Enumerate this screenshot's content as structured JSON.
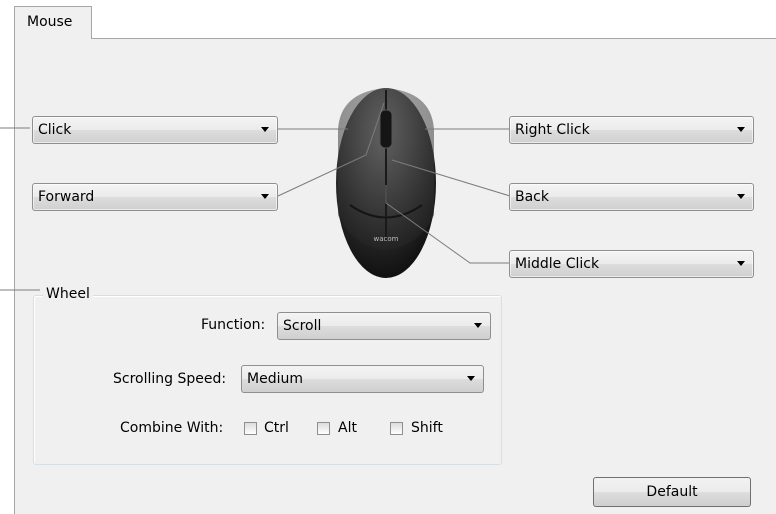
{
  "tab": {
    "label": "Mouse"
  },
  "buttons": {
    "left": {
      "value": "Click"
    },
    "left_side": {
      "value": "Forward"
    },
    "right": {
      "value": "Right Click"
    },
    "right_side": {
      "value": "Back"
    },
    "middle": {
      "value": "Middle Click"
    }
  },
  "mouse": {
    "brand": "wacom"
  },
  "wheel": {
    "title": "Wheel",
    "function_label": "Function:",
    "function_value": "Scroll",
    "speed_label": "Scrolling Speed:",
    "speed_value": "Medium",
    "combine_label": "Combine With:",
    "modifiers": [
      {
        "label": "Ctrl",
        "checked": false
      },
      {
        "label": "Alt",
        "checked": false
      },
      {
        "label": "Shift",
        "checked": false
      }
    ]
  },
  "default_button": "Default"
}
